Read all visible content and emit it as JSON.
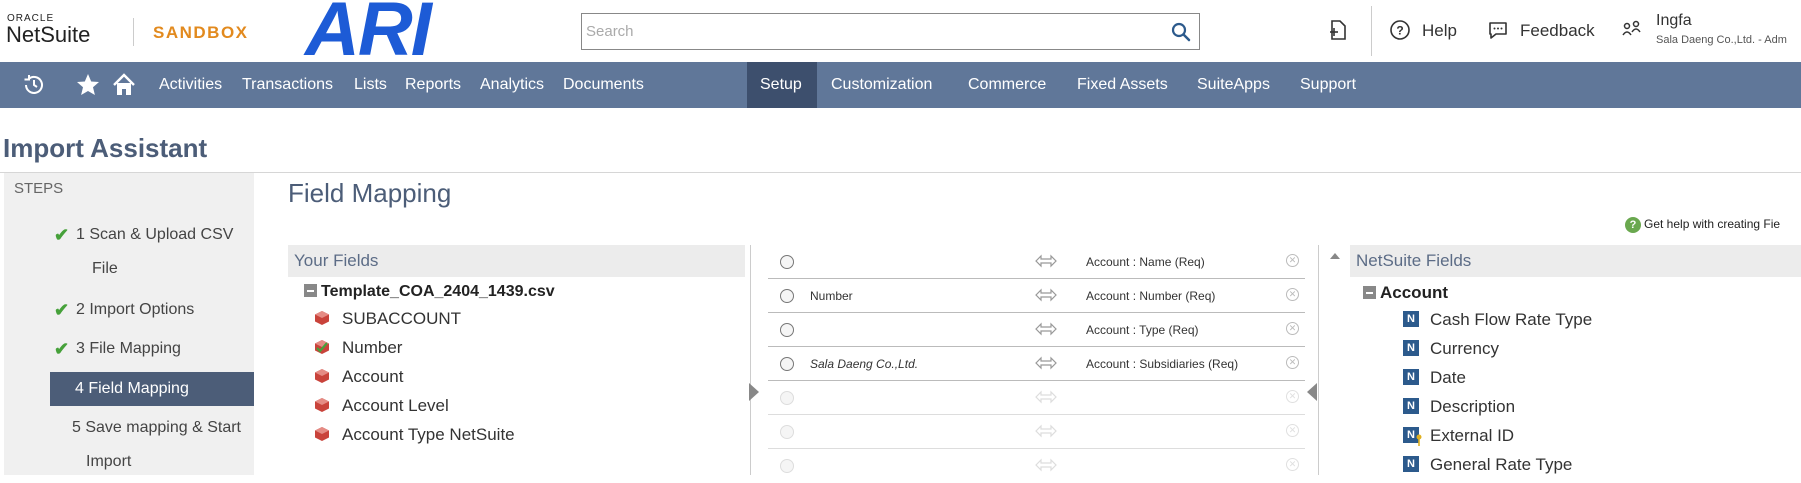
{
  "header": {
    "oracle_label": "ORACLE",
    "netsuite_label": "NetSuite",
    "sandbox_label": "SANDBOX",
    "brand_logo": "ARI",
    "search_placeholder": "Search",
    "help_label": "Help",
    "feedback_label": "Feedback",
    "user_name": "Ingfa",
    "user_company": "Sala Daeng Co.,Ltd. - Adm"
  },
  "nav": {
    "items": [
      "Activities",
      "Transactions",
      "Lists",
      "Reports",
      "Analytics",
      "Documents",
      "Setup",
      "Customization",
      "Commerce",
      "Fixed Assets",
      "SuiteApps",
      "Support"
    ],
    "active": "Setup"
  },
  "page": {
    "title": "Import Assistant"
  },
  "steps": {
    "heading": "STEPS",
    "items": [
      {
        "line1": "1 Scan & Upload CSV",
        "line2": "File",
        "done": true
      },
      {
        "line1": "2 Import Options",
        "done": true
      },
      {
        "line1": "3 File Mapping",
        "done": true
      },
      {
        "line1": "4 Field Mapping",
        "done": false,
        "active": true
      },
      {
        "line1": "5 Save mapping & Start",
        "line2": "Import",
        "done": false
      }
    ]
  },
  "main": {
    "title": "Field Mapping",
    "help_text": "Get help with creating Fie"
  },
  "your_fields": {
    "heading": "Your Fields",
    "file_name": "Template_COA_2404_1439.csv",
    "fields": [
      "SUBACCOUNT",
      "Number",
      "Account",
      "Account Level",
      "Account Type NetSuite"
    ]
  },
  "mappings": [
    {
      "source": "",
      "target": "Account : Name (Req)"
    },
    {
      "source": "Number",
      "target": "Account : Number (Req)"
    },
    {
      "source": "",
      "target": "Account : Type (Req)"
    },
    {
      "source": "Sala Daeng Co.,Ltd.",
      "target": "Account : Subsidiaries (Req)"
    },
    {
      "source": "",
      "target": ""
    },
    {
      "source": "",
      "target": ""
    },
    {
      "source": "",
      "target": ""
    }
  ],
  "netsuite_fields": {
    "heading": "NetSuite Fields",
    "record": "Account",
    "fields": [
      "Cash Flow Rate Type",
      "Currency",
      "Date",
      "Description",
      "External ID",
      "General Rate Type"
    ]
  },
  "colors": {
    "nav_bg": "#607799",
    "nav_active": "#3d4f6d",
    "title_color": "#4c5d78",
    "check_green": "#46a13a",
    "brand_blue": "#1d5bd6",
    "sandbox_orange": "#e28a1e"
  }
}
